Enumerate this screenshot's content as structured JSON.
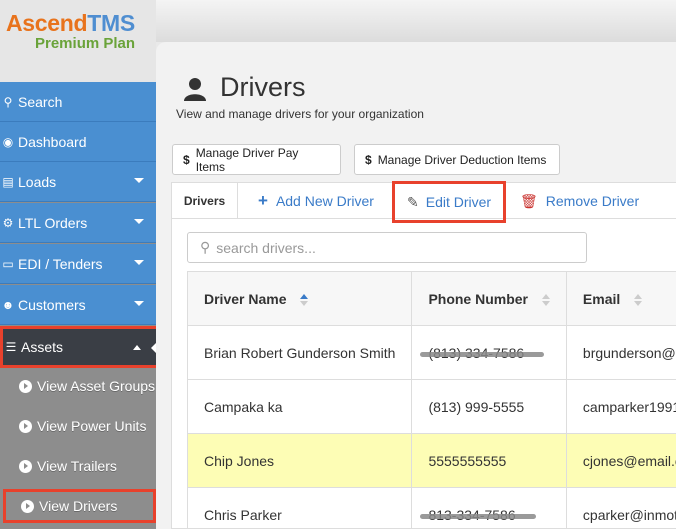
{
  "brand": {
    "name_part1": "Ascend",
    "name_part2": "TMS",
    "plan": "Premium Plan"
  },
  "sidebar": {
    "items": [
      {
        "label": "Search",
        "icon": "search-icon"
      },
      {
        "label": "Dashboard",
        "icon": "dashboard-icon"
      },
      {
        "label": "Loads",
        "icon": "list-icon"
      },
      {
        "label": "LTL Orders",
        "icon": "network-icon"
      },
      {
        "label": "EDI / Tenders",
        "icon": "inbox-icon"
      },
      {
        "label": "Customers",
        "icon": "users-icon"
      },
      {
        "label": "Assets",
        "icon": "columns-icon"
      }
    ],
    "subitems": [
      {
        "label": "View Asset Groups"
      },
      {
        "label": "View Power Units"
      },
      {
        "label": "View Trailers"
      },
      {
        "label": "View Drivers"
      }
    ]
  },
  "page": {
    "title": "Drivers",
    "subtitle": "View and manage drivers for your organization"
  },
  "actions": {
    "pay_items": "Manage Driver Pay Items",
    "deduction_items": "Manage Driver Deduction Items",
    "currency_symbol": "$"
  },
  "tabs": {
    "drivers": "Drivers",
    "add": "Add New Driver",
    "edit": "Edit Driver",
    "remove": "Remove Driver"
  },
  "search": {
    "placeholder": "search drivers..."
  },
  "table": {
    "headers": [
      "Driver Name",
      "Phone Number",
      "Email"
    ],
    "rows": [
      {
        "name": "Brian Robert Gunderson Smith",
        "phone": "(813) 334-7586",
        "email": "brgunderson@te"
      },
      {
        "name": "Campaka ka",
        "phone": "(813) 999-5555",
        "email": "camparker1991"
      },
      {
        "name": "Chip Jones",
        "phone": "5555555555",
        "email": "cjones@email.co"
      },
      {
        "name": "Chris Parker",
        "phone": "813-334-7586",
        "email": "cparker@inmoti"
      }
    ]
  },
  "colors": {
    "accent": "#4a8fd1",
    "highlight": "#e8412c",
    "selected_row": "#fdfdb5"
  }
}
